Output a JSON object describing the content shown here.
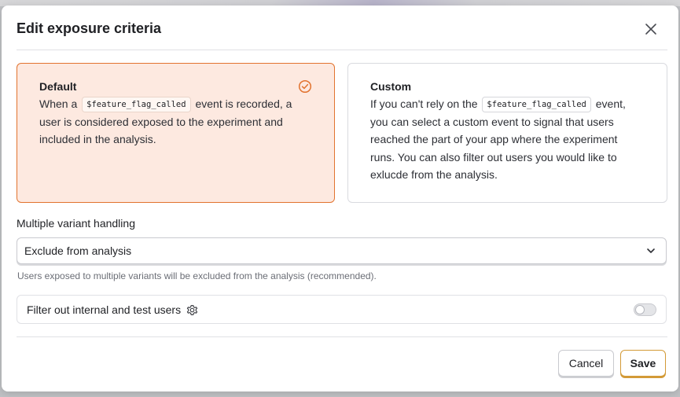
{
  "modal": {
    "title": "Edit exposure criteria"
  },
  "colors": {
    "accent": "#e2732f",
    "selected_bg": "#fde9e0",
    "save_border": "#d39a37"
  },
  "options": [
    {
      "title": "Default",
      "selected": true,
      "desc_before": "When a",
      "code": "$feature_flag_called",
      "desc_mid": "event is recorded, a user is considered",
      "desc_strong": "exposed",
      "desc_after": "to the experiment and included in the analysis.",
      "icon": "check-circle-icon"
    },
    {
      "title": "Custom",
      "selected": false,
      "desc_before": "If you can't rely on the",
      "code": "$feature_flag_called",
      "desc_after": "event, you can select a custom event to signal that users reached the part of your app where the experiment runs. You can also filter out users you would like to exlucde from the analysis."
    }
  ],
  "variant_handling": {
    "label": "Multiple variant handling",
    "selected_value": "Exclude from analysis",
    "help_text": "Users exposed to multiple variants will be excluded from the analysis (recommended).",
    "icon": "chevron-down-icon"
  },
  "filter_internal": {
    "label": "Filter out internal and test users",
    "enabled": false,
    "icon": "gear-icon"
  },
  "footer": {
    "cancel_label": "Cancel",
    "save_label": "Save"
  }
}
